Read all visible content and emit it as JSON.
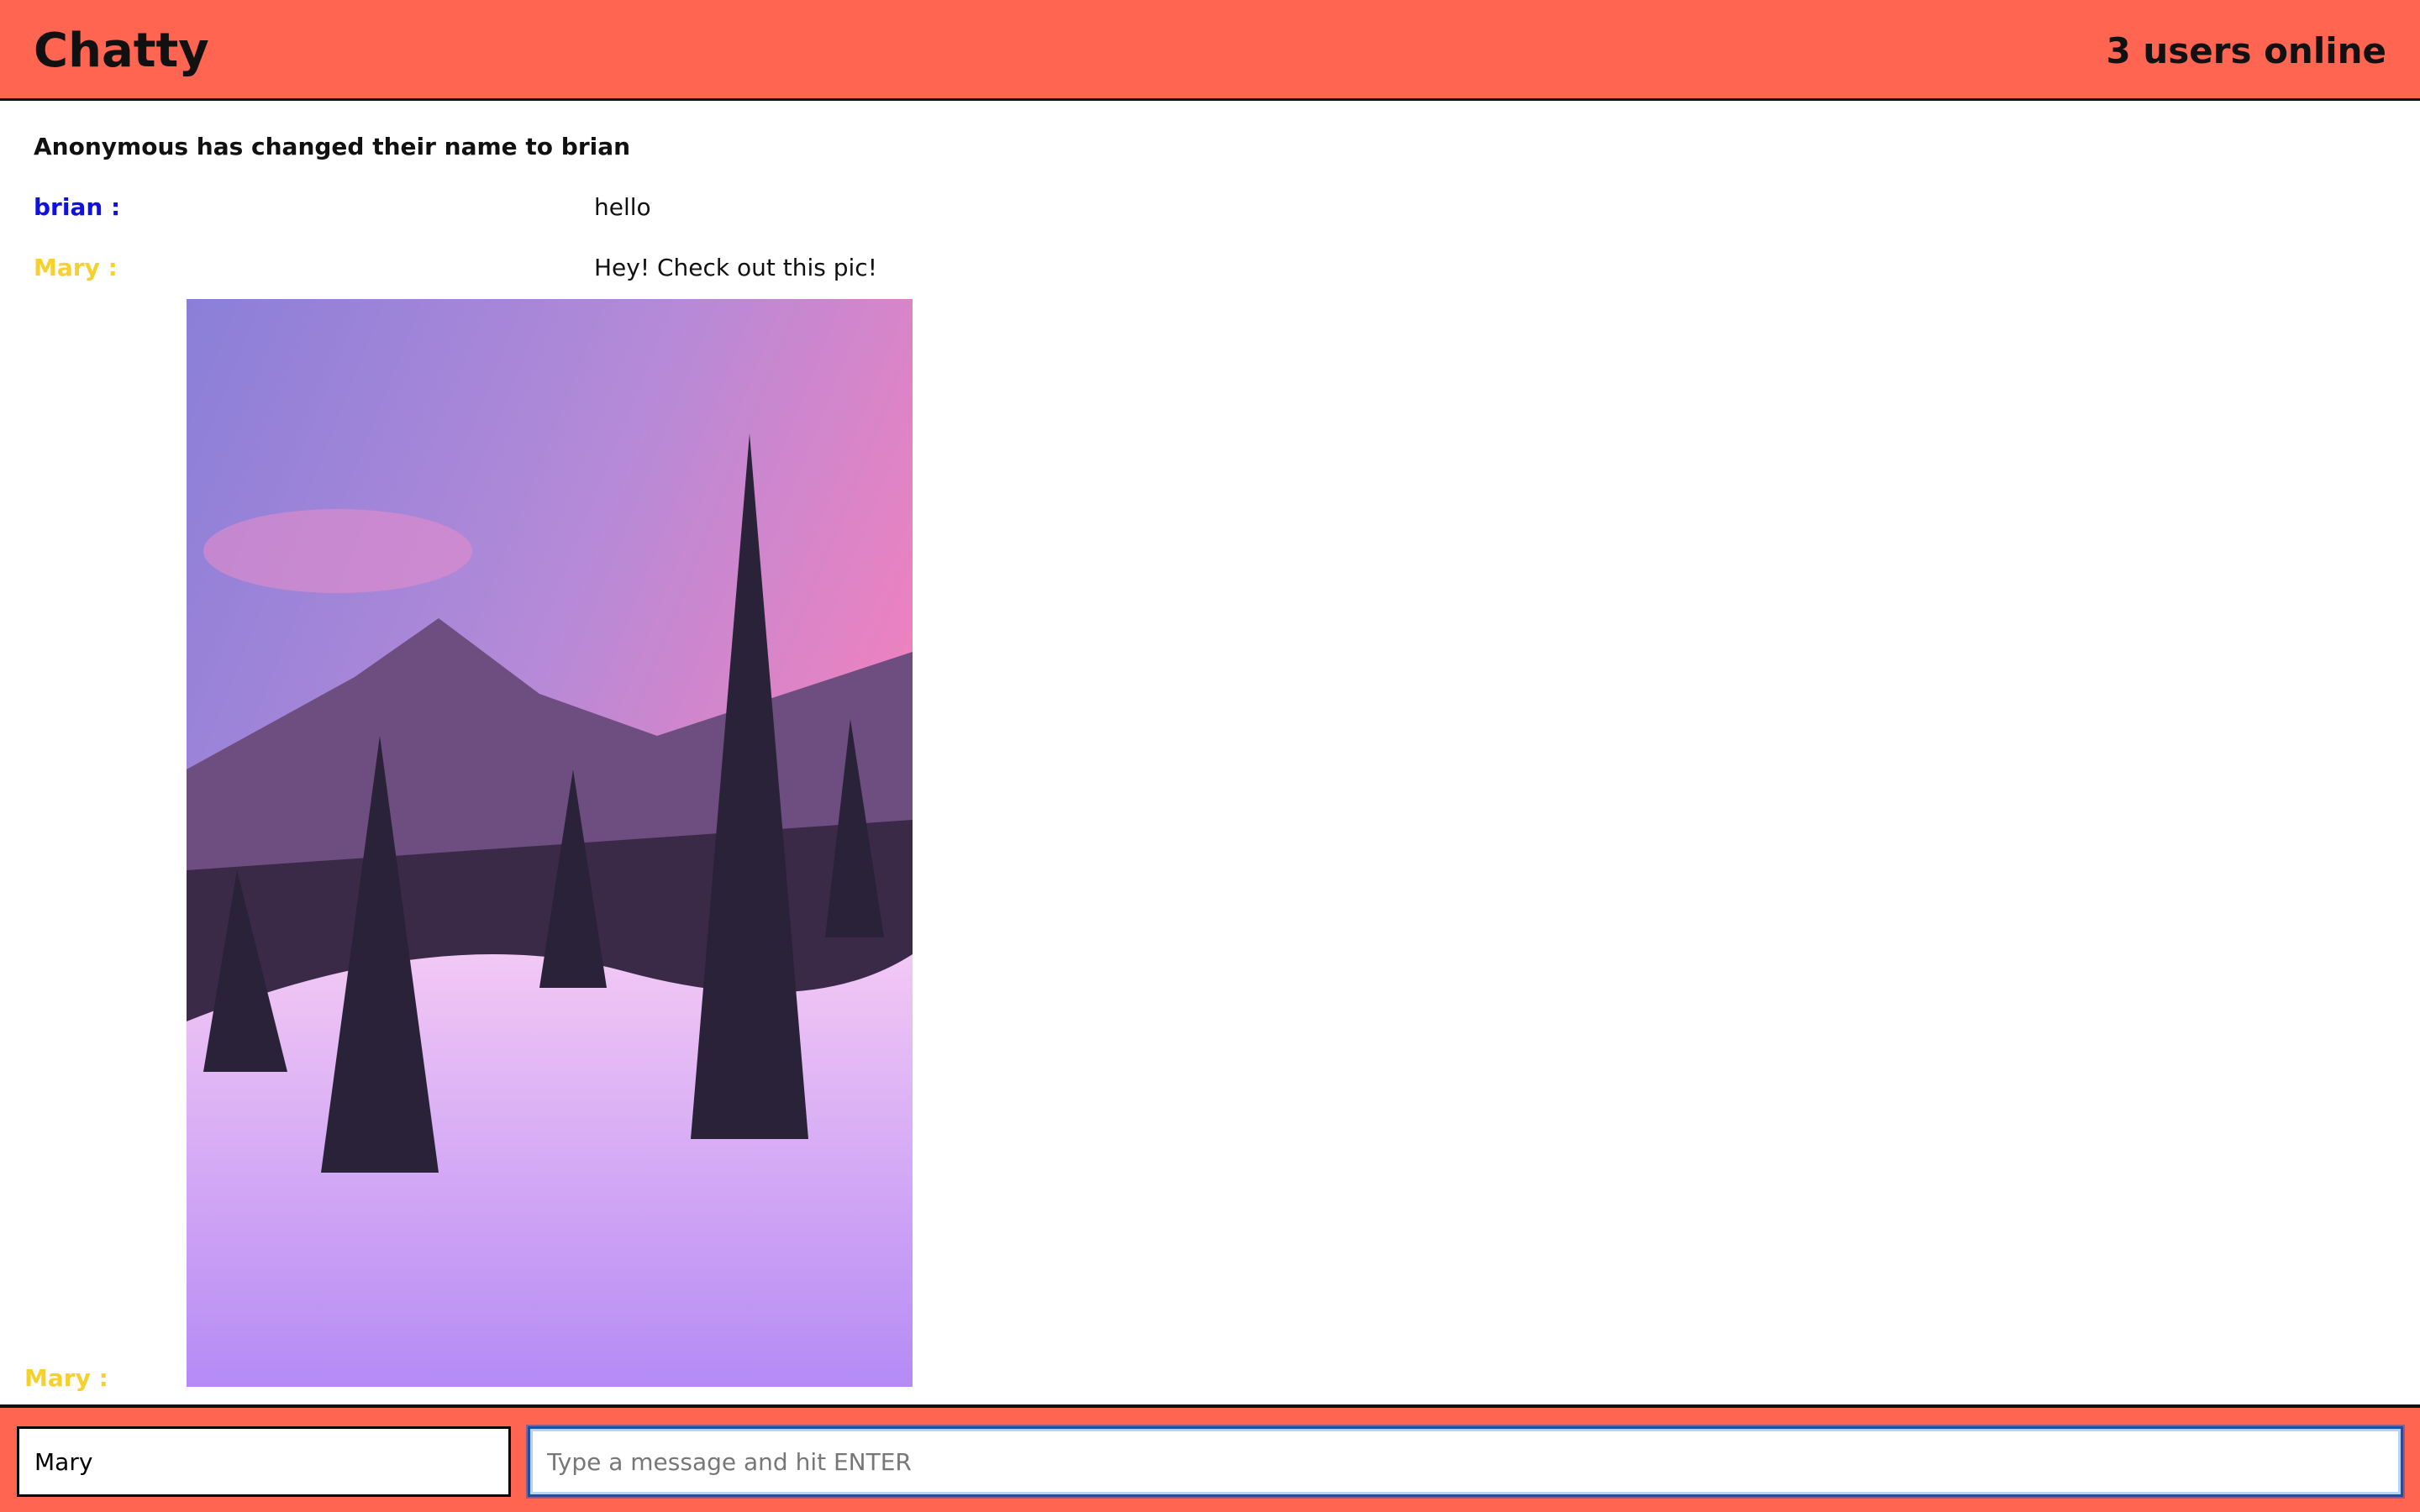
{
  "header": {
    "title": "Chatty",
    "users_online": "3 users online"
  },
  "messages": [
    {
      "type": "notice",
      "text": "Anonymous has changed their name to brian"
    },
    {
      "type": "message",
      "user": "brian :",
      "text": "hello",
      "color": "#1010e0"
    },
    {
      "type": "message",
      "user": "Mary :",
      "text": "Hey! Check out this pic!",
      "color": "#f7d02c"
    },
    {
      "type": "image",
      "user": "Mary :",
      "color": "#f7d02c"
    }
  ],
  "footer": {
    "username": "Mary",
    "message_placeholder": "Type a message and hit ENTER"
  }
}
